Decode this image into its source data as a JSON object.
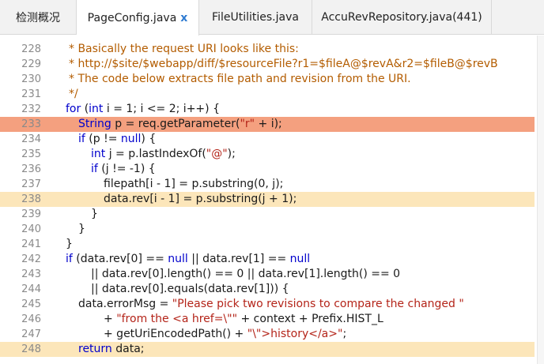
{
  "tabs": [
    {
      "label": "检测概况",
      "active": false
    },
    {
      "label": "PageConfig.java",
      "active": true,
      "close": "x"
    },
    {
      "label": "FileUtilities.java",
      "active": false
    },
    {
      "label": "AccuRevRepository.java(441)",
      "active": false
    }
  ],
  "colors": {
    "highlight_strong": "#f4a07f",
    "highlight_soft": "#fce6ba",
    "keyword": "#0000cc",
    "string": "#b42419",
    "comment": "#b35c00"
  },
  "lines": [
    {
      "num": "228",
      "indent": 6,
      "tokens": [
        [
          "cm",
          "* Basically the request URI looks like this:"
        ]
      ]
    },
    {
      "num": "229",
      "indent": 6,
      "tokens": [
        [
          "cm",
          "* http://$site/$webapp/diff/$resourceFile?r1=$fileA@$revA&r2=$fileB@$revB"
        ]
      ]
    },
    {
      "num": "230",
      "indent": 6,
      "tokens": [
        [
          "cm",
          "* The code below extracts file path and revision from the URI."
        ]
      ]
    },
    {
      "num": "231",
      "indent": 6,
      "tokens": [
        [
          "cm",
          "*/"
        ]
      ]
    },
    {
      "num": "232",
      "indent": 5,
      "tokens": [
        [
          "kw",
          "for"
        ],
        [
          "tx",
          " ("
        ],
        [
          "kw",
          "int"
        ],
        [
          "tx",
          " i = 1; i <= 2; i++) {"
        ]
      ]
    },
    {
      "num": "233",
      "indent": 9,
      "hl": "strong",
      "tokens": [
        [
          "kw",
          "String"
        ],
        [
          "tx",
          " p = req.getParameter("
        ],
        [
          "str",
          "\"r\""
        ],
        [
          "tx",
          " + i);"
        ]
      ]
    },
    {
      "num": "234",
      "indent": 9,
      "tokens": [
        [
          "kw",
          "if"
        ],
        [
          "tx",
          " (p != "
        ],
        [
          "kw",
          "null"
        ],
        [
          "tx",
          ") {"
        ]
      ]
    },
    {
      "num": "235",
      "indent": 13,
      "tokens": [
        [
          "kw",
          "int"
        ],
        [
          "tx",
          " j = p.lastIndexOf("
        ],
        [
          "str",
          "\"@\""
        ],
        [
          "tx",
          ");"
        ]
      ]
    },
    {
      "num": "236",
      "indent": 13,
      "tokens": [
        [
          "kw",
          "if"
        ],
        [
          "tx",
          " (j != -1) {"
        ]
      ]
    },
    {
      "num": "237",
      "indent": 17,
      "tokens": [
        [
          "tx",
          "filepath[i - 1] = p.substring(0, j);"
        ]
      ]
    },
    {
      "num": "238",
      "indent": 17,
      "hl": "soft",
      "tokens": [
        [
          "tx",
          "data.rev[i - 1] = p.substring(j + 1);"
        ]
      ]
    },
    {
      "num": "239",
      "indent": 13,
      "tokens": [
        [
          "tx",
          "}"
        ]
      ]
    },
    {
      "num": "240",
      "indent": 9,
      "tokens": [
        [
          "tx",
          "}"
        ]
      ]
    },
    {
      "num": "241",
      "indent": 5,
      "tokens": [
        [
          "tx",
          "}"
        ]
      ]
    },
    {
      "num": "242",
      "indent": 5,
      "tokens": [
        [
          "kw",
          "if"
        ],
        [
          "tx",
          " (data.rev[0] == "
        ],
        [
          "kw",
          "null"
        ],
        [
          "tx",
          " || data.rev[1] == "
        ],
        [
          "kw",
          "null"
        ]
      ]
    },
    {
      "num": "243",
      "indent": 13,
      "tokens": [
        [
          "tx",
          "|| data.rev[0].length() == 0 || data.rev[1].length() == 0"
        ]
      ]
    },
    {
      "num": "244",
      "indent": 13,
      "tokens": [
        [
          "tx",
          "|| data.rev[0].equals(data.rev[1])) {"
        ]
      ]
    },
    {
      "num": "245",
      "indent": 9,
      "tokens": [
        [
          "tx",
          "data.errorMsg = "
        ],
        [
          "str",
          "\"Please pick two revisions to compare the changed \""
        ]
      ]
    },
    {
      "num": "246",
      "indent": 17,
      "tokens": [
        [
          "tx",
          "+ "
        ],
        [
          "str",
          "\"from the <a href=\\\"\""
        ],
        [
          "tx",
          " + context + Prefix.HIST_L"
        ]
      ]
    },
    {
      "num": "247",
      "indent": 17,
      "tokens": [
        [
          "tx",
          "+ getUriEncodedPath() + "
        ],
        [
          "str",
          "\"\\\">history</a>\""
        ],
        [
          "tx",
          ";"
        ]
      ]
    },
    {
      "num": "248",
      "indent": 9,
      "hl": "soft",
      "tokens": [
        [
          "kw",
          "return"
        ],
        [
          "tx",
          " data;"
        ]
      ]
    }
  ]
}
